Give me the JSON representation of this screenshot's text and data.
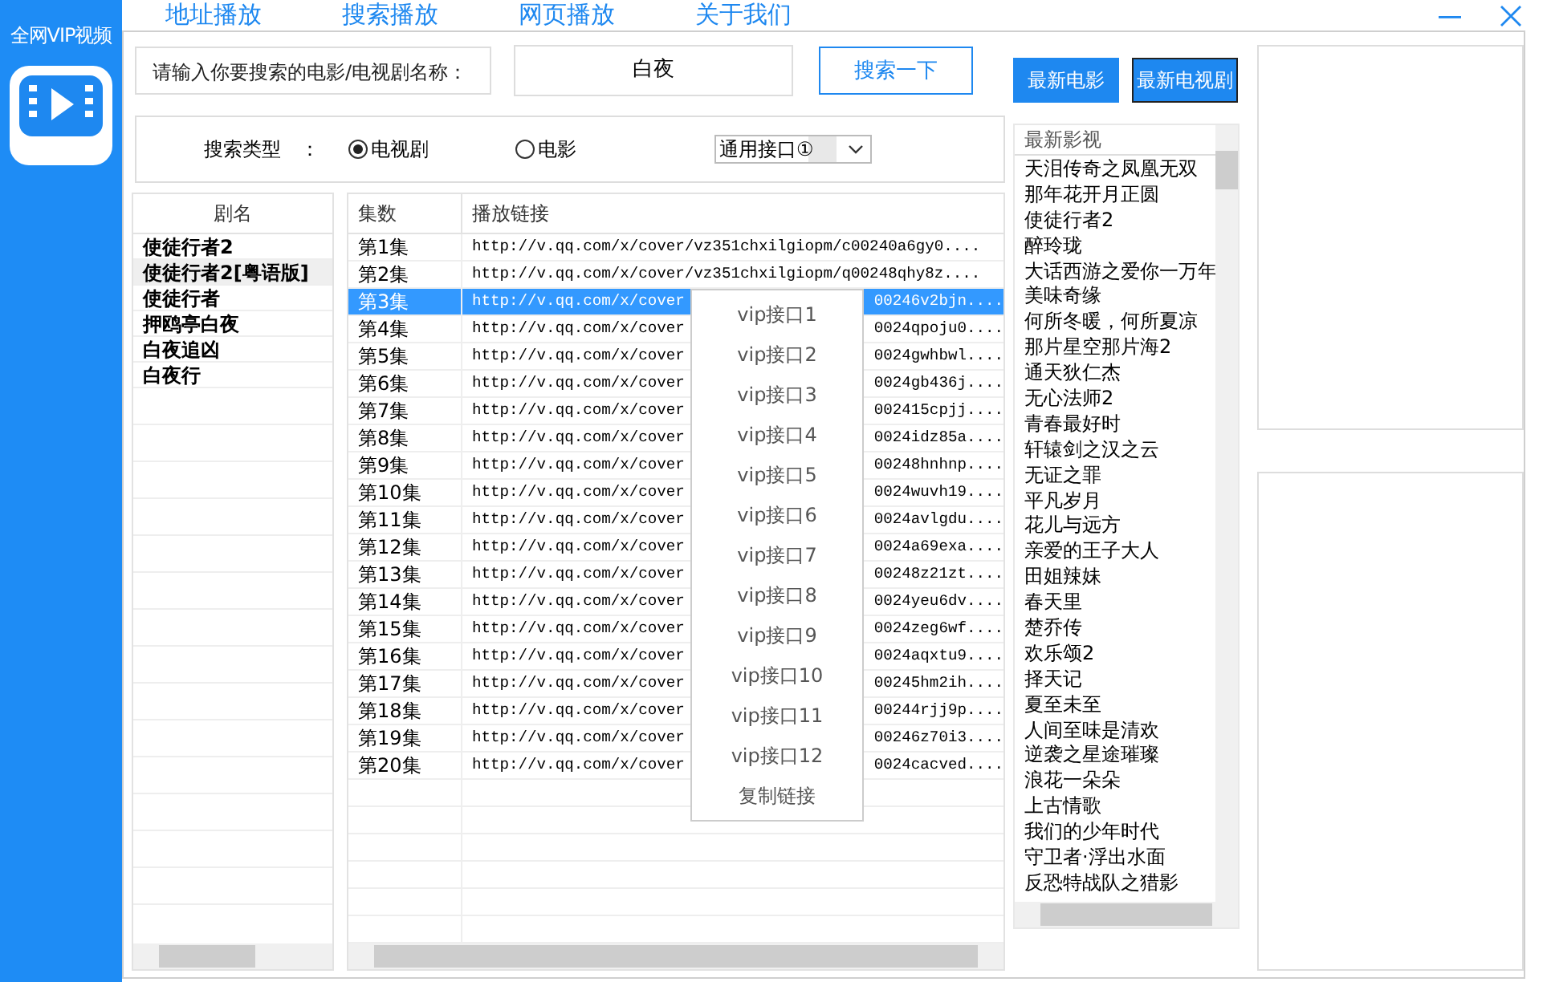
{
  "app": {
    "title": "全网VIP视频"
  },
  "nav": [
    "地址播放",
    "搜索播放",
    "网页播放",
    "关于我们"
  ],
  "search": {
    "label": "请输入你要搜索的电影/电视剧名称：",
    "value": "白夜",
    "button": "搜索一下"
  },
  "search_type": {
    "label": "搜索类型　：",
    "options": [
      {
        "label": "电视剧",
        "selected": true
      },
      {
        "label": "电影",
        "selected": false
      }
    ],
    "interface": "通用接口①"
  },
  "latest_buttons": [
    {
      "label": "最新电影",
      "selected": false
    },
    {
      "label": "最新电视剧",
      "selected": true
    }
  ],
  "series_list": {
    "header": "剧名",
    "items": [
      {
        "name": "使徒行者2",
        "selected": false
      },
      {
        "name": "使徒行者2[粤语版]",
        "selected": true
      },
      {
        "name": "使徒行者",
        "selected": false
      },
      {
        "name": "押鸥亭白夜",
        "selected": false
      },
      {
        "name": "白夜追凶",
        "selected": false
      },
      {
        "name": "白夜行",
        "selected": false
      }
    ]
  },
  "episodes": {
    "columns": [
      "集数",
      "播放链接"
    ],
    "rows": [
      {
        "episode": "第1集",
        "link": [
          "http://v.qq.com/x/cover/vz351chxilgiopm/c00240a6gy0...."
        ],
        "selected": false
      },
      {
        "episode": "第2集",
        "link": [
          "http://v.qq.com/x/cover/vz351chxilgiopm/q00248qhy8z...."
        ],
        "selected": false
      },
      {
        "episode": "第3集",
        "link": [
          "http://v.qq.com/x/cover",
          "00246v2bjn...."
        ],
        "selected": true
      },
      {
        "episode": "第4集",
        "link": [
          "http://v.qq.com/x/cover",
          "0024qpoju0...."
        ],
        "selected": false
      },
      {
        "episode": "第5集",
        "link": [
          "http://v.qq.com/x/cover",
          "0024gwhbwl...."
        ],
        "selected": false
      },
      {
        "episode": "第6集",
        "link": [
          "http://v.qq.com/x/cover",
          "0024gb436j...."
        ],
        "selected": false
      },
      {
        "episode": "第7集",
        "link": [
          "http://v.qq.com/x/cover",
          "002415cpjj...."
        ],
        "selected": false
      },
      {
        "episode": "第8集",
        "link": [
          "http://v.qq.com/x/cover",
          "0024idz85a...."
        ],
        "selected": false
      },
      {
        "episode": "第9集",
        "link": [
          "http://v.qq.com/x/cover",
          "00248hnhnp...."
        ],
        "selected": false
      },
      {
        "episode": "第10集",
        "link": [
          "http://v.qq.com/x/cover",
          "0024wuvh19...."
        ],
        "selected": false
      },
      {
        "episode": "第11集",
        "link": [
          "http://v.qq.com/x/cover",
          "0024avlgdu...."
        ],
        "selected": false
      },
      {
        "episode": "第12集",
        "link": [
          "http://v.qq.com/x/cover",
          "0024a69exa...."
        ],
        "selected": false
      },
      {
        "episode": "第13集",
        "link": [
          "http://v.qq.com/x/cover",
          "00248z21zt...."
        ],
        "selected": false
      },
      {
        "episode": "第14集",
        "link": [
          "http://v.qq.com/x/cover",
          "0024yeu6dv...."
        ],
        "selected": false
      },
      {
        "episode": "第15集",
        "link": [
          "http://v.qq.com/x/cover",
          "0024zeg6wf...."
        ],
        "selected": false
      },
      {
        "episode": "第16集",
        "link": [
          "http://v.qq.com/x/cover",
          "0024aqxtu9...."
        ],
        "selected": false
      },
      {
        "episode": "第17集",
        "link": [
          "http://v.qq.com/x/cover",
          "00245hm2ih...."
        ],
        "selected": false
      },
      {
        "episode": "第18集",
        "link": [
          "http://v.qq.com/x/cover",
          "00244rjj9p...."
        ],
        "selected": false
      },
      {
        "episode": "第19集",
        "link": [
          "http://v.qq.com/x/cover",
          "00246z70i3...."
        ],
        "selected": false
      },
      {
        "episode": "第20集",
        "link": [
          "http://v.qq.com/x/cover",
          "0024cacved...."
        ],
        "selected": false
      }
    ]
  },
  "context_menu": [
    "vip接口1",
    "vip接口2",
    "vip接口3",
    "vip接口4",
    "vip接口5",
    "vip接口6",
    "vip接口7",
    "vip接口8",
    "vip接口9",
    "vip接口10",
    "vip接口11",
    "vip接口12",
    "复制链接"
  ],
  "latest": {
    "header": "最新影视",
    "items": [
      "天泪传奇之凤凰无双",
      "那年花开月正圆",
      "使徒行者2",
      "醉玲珑",
      "大话西游之爱你一万年",
      "美味奇缘",
      "何所冬暖，何所夏凉",
      "那片星空那片海2",
      "通天狄仁杰",
      "无心法师2",
      "青春最好时",
      "轩辕剑之汉之云",
      "无证之罪",
      "平凡岁月",
      "花儿与远方",
      "亲爱的王子大人",
      "田姐辣妹",
      "春天里",
      "楚乔传",
      "欢乐颂2",
      "择天记",
      "夏至未至",
      "人间至味是清欢",
      "逆袭之星途璀璨",
      "浪花一朵朵",
      "上古情歌",
      "我们的少年时代",
      "守卫者·浮出水面",
      "反恐特战队之猎影"
    ]
  }
}
